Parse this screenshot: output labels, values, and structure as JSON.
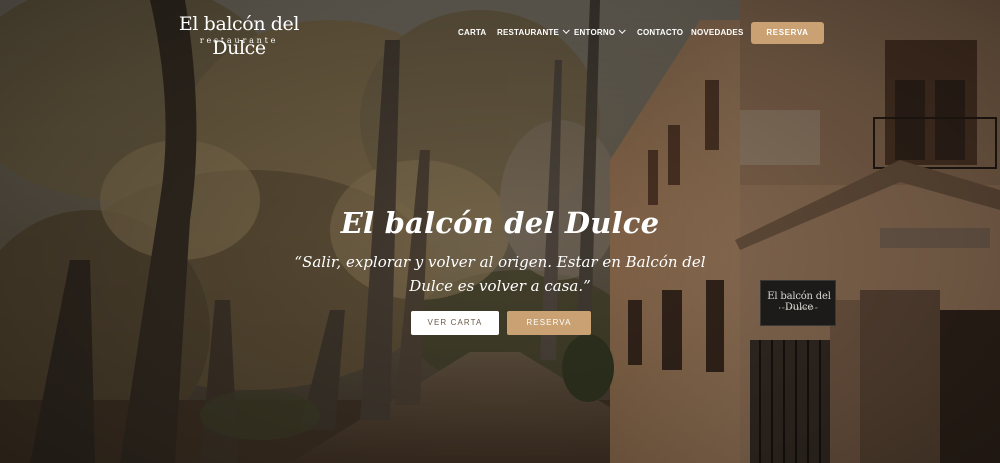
{
  "brand": {
    "name": "El balcón del Dulce",
    "subtitle": "restaurante"
  },
  "nav": {
    "items": [
      {
        "label": "CARTA",
        "dropdown": false
      },
      {
        "label": "RESTAURANTE",
        "dropdown": true
      },
      {
        "label": "ENTORNO",
        "dropdown": true
      },
      {
        "label": "CONTACTO",
        "dropdown": false
      },
      {
        "label": "NOVEDADES",
        "dropdown": false
      }
    ],
    "cta_label": "RESERVA"
  },
  "hero": {
    "title": "El balcón del Dulce",
    "quote_line1": "“Salir, explorar y volver al origen. Estar en Balcón del",
    "quote_line2": "Dulce es volver a casa.”",
    "button_menu": "VER CARTA",
    "button_reserve": "RESERVA"
  },
  "sign": {
    "name": "El balcón del Dulce",
    "subtitle": "restaurante"
  },
  "colors": {
    "accent": "#c9a173",
    "text_light": "#ffffff",
    "button_light_text": "#6b5a48"
  }
}
